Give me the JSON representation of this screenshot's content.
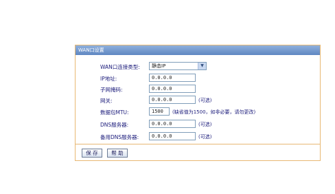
{
  "panel": {
    "title": "WAN口设置"
  },
  "form": {
    "wan_type_label": "WAN口连接类型:",
    "wan_type_value": "静态IP",
    "ip_label": "IP地址:",
    "ip_value": "0.0.0.0",
    "subnet_label": "子网掩码:",
    "subnet_value": "0.0.0.0",
    "gateway_label": "网关:",
    "gateway_value": "0.0.0.0",
    "gateway_note": "(可选)",
    "mtu_label": "数据包MTU:",
    "mtu_value": "1500",
    "mtu_note": "(缺省值为1500，如非必要，请勿更改)",
    "dns_label": "DNS服务器:",
    "dns_value": "0.0.0.0",
    "dns_note": "(可选)",
    "dns2_label": "备用DNS服务器:",
    "dns2_value": "0.0.0.0",
    "dns2_note": "(可选)"
  },
  "buttons": {
    "save": "保 存",
    "help": "帮 助"
  }
}
